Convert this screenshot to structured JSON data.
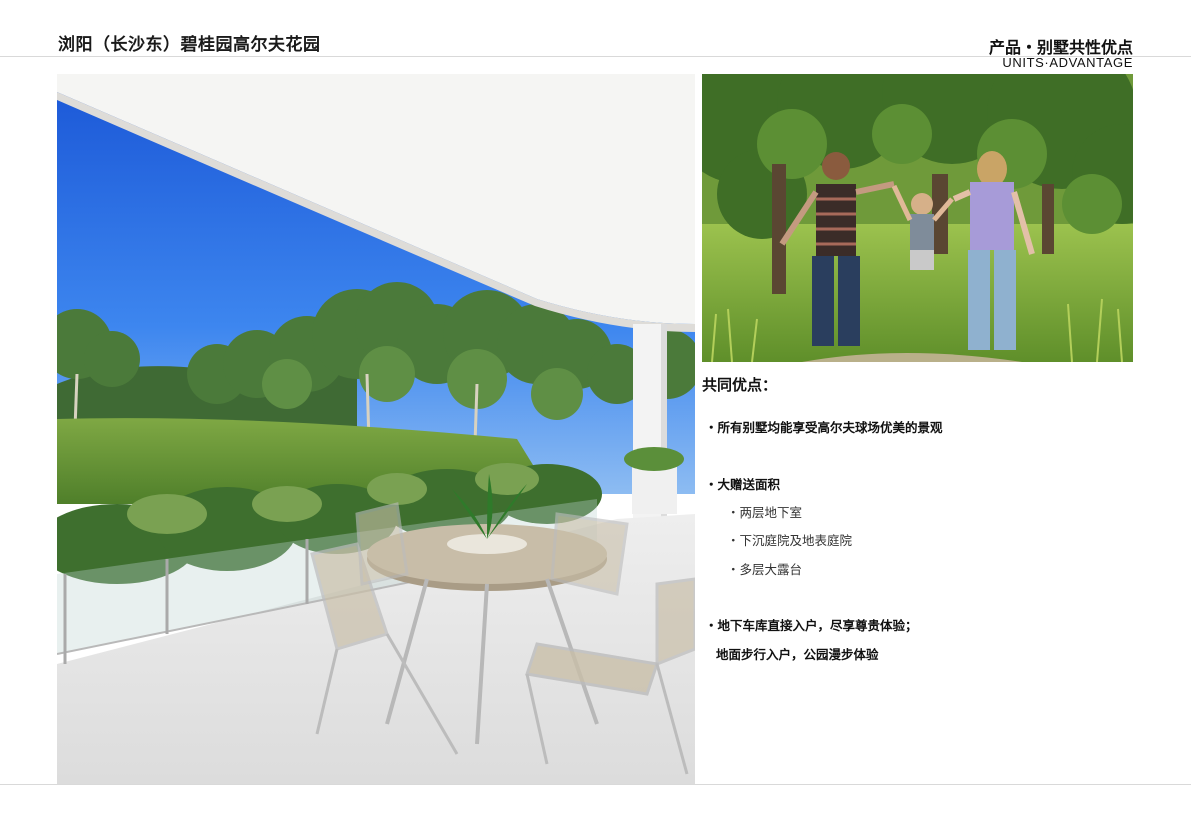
{
  "header": {
    "project_title": "浏阳（长沙东）碧桂园高尔夫花园",
    "section_title_cn": "产品・别墅共性优点",
    "section_title_en": "UNITS·ADVANTAGE"
  },
  "advantages": {
    "heading": "共同优点：",
    "item1": "・所有别墅均能享受高尔夫球场优美的景观",
    "item2": "・大赠送面积",
    "item2_sub1": "・两层地下室",
    "item2_sub2": "・下沉庭院及地表庭院",
    "item2_sub3": "・多层大露台",
    "item3": "・地下车库直接入户，尽享尊贵体验；",
    "item3_cont": "地面步行入户，公园漫步体验"
  }
}
